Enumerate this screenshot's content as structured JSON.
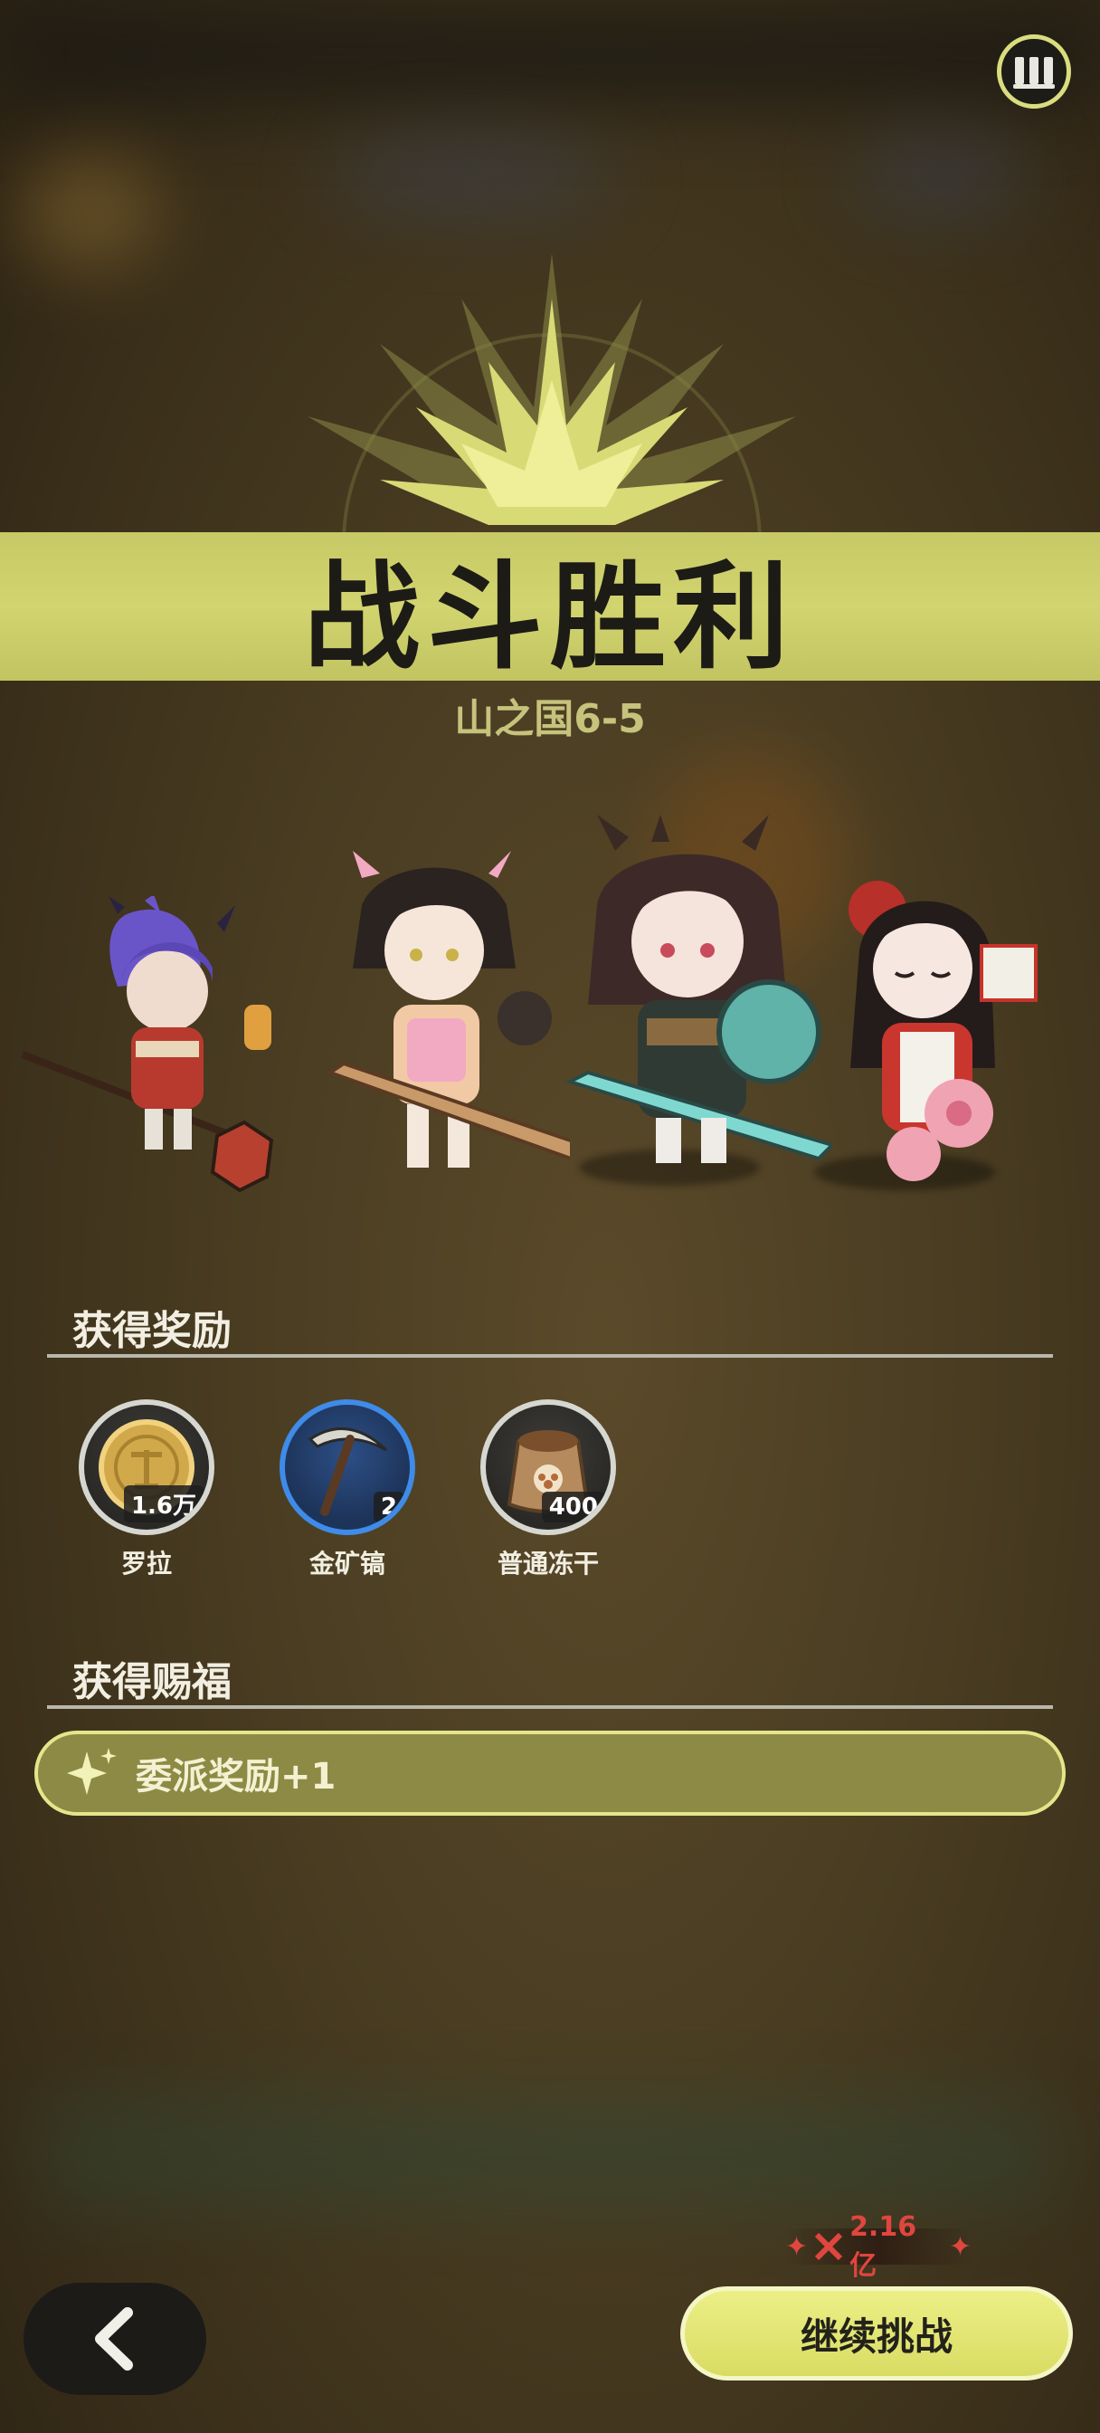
{
  "result": {
    "title": "战斗胜利",
    "stage": "山之国6-5"
  },
  "rewards": {
    "section_title": "获得奖励",
    "items": [
      {
        "name": "罗拉",
        "quantity": "1.6万",
        "icon": "gold-coin-icon"
      },
      {
        "name": "金矿镐",
        "quantity": "2",
        "icon": "pickaxe-icon"
      },
      {
        "name": "普通冻干",
        "quantity": "400",
        "icon": "food-bag-icon"
      }
    ]
  },
  "blessings": {
    "section_title": "获得赐福",
    "items": [
      {
        "text": "委派奖励+1",
        "icon": "sparkle-icon"
      }
    ]
  },
  "footer": {
    "power": "2.16亿",
    "continue_label": "继续挑战"
  },
  "colors": {
    "accent": "#d2d46f",
    "button": "#e4e778",
    "power_red": "#e0463f",
    "rare_blue": "#3f8be8"
  }
}
